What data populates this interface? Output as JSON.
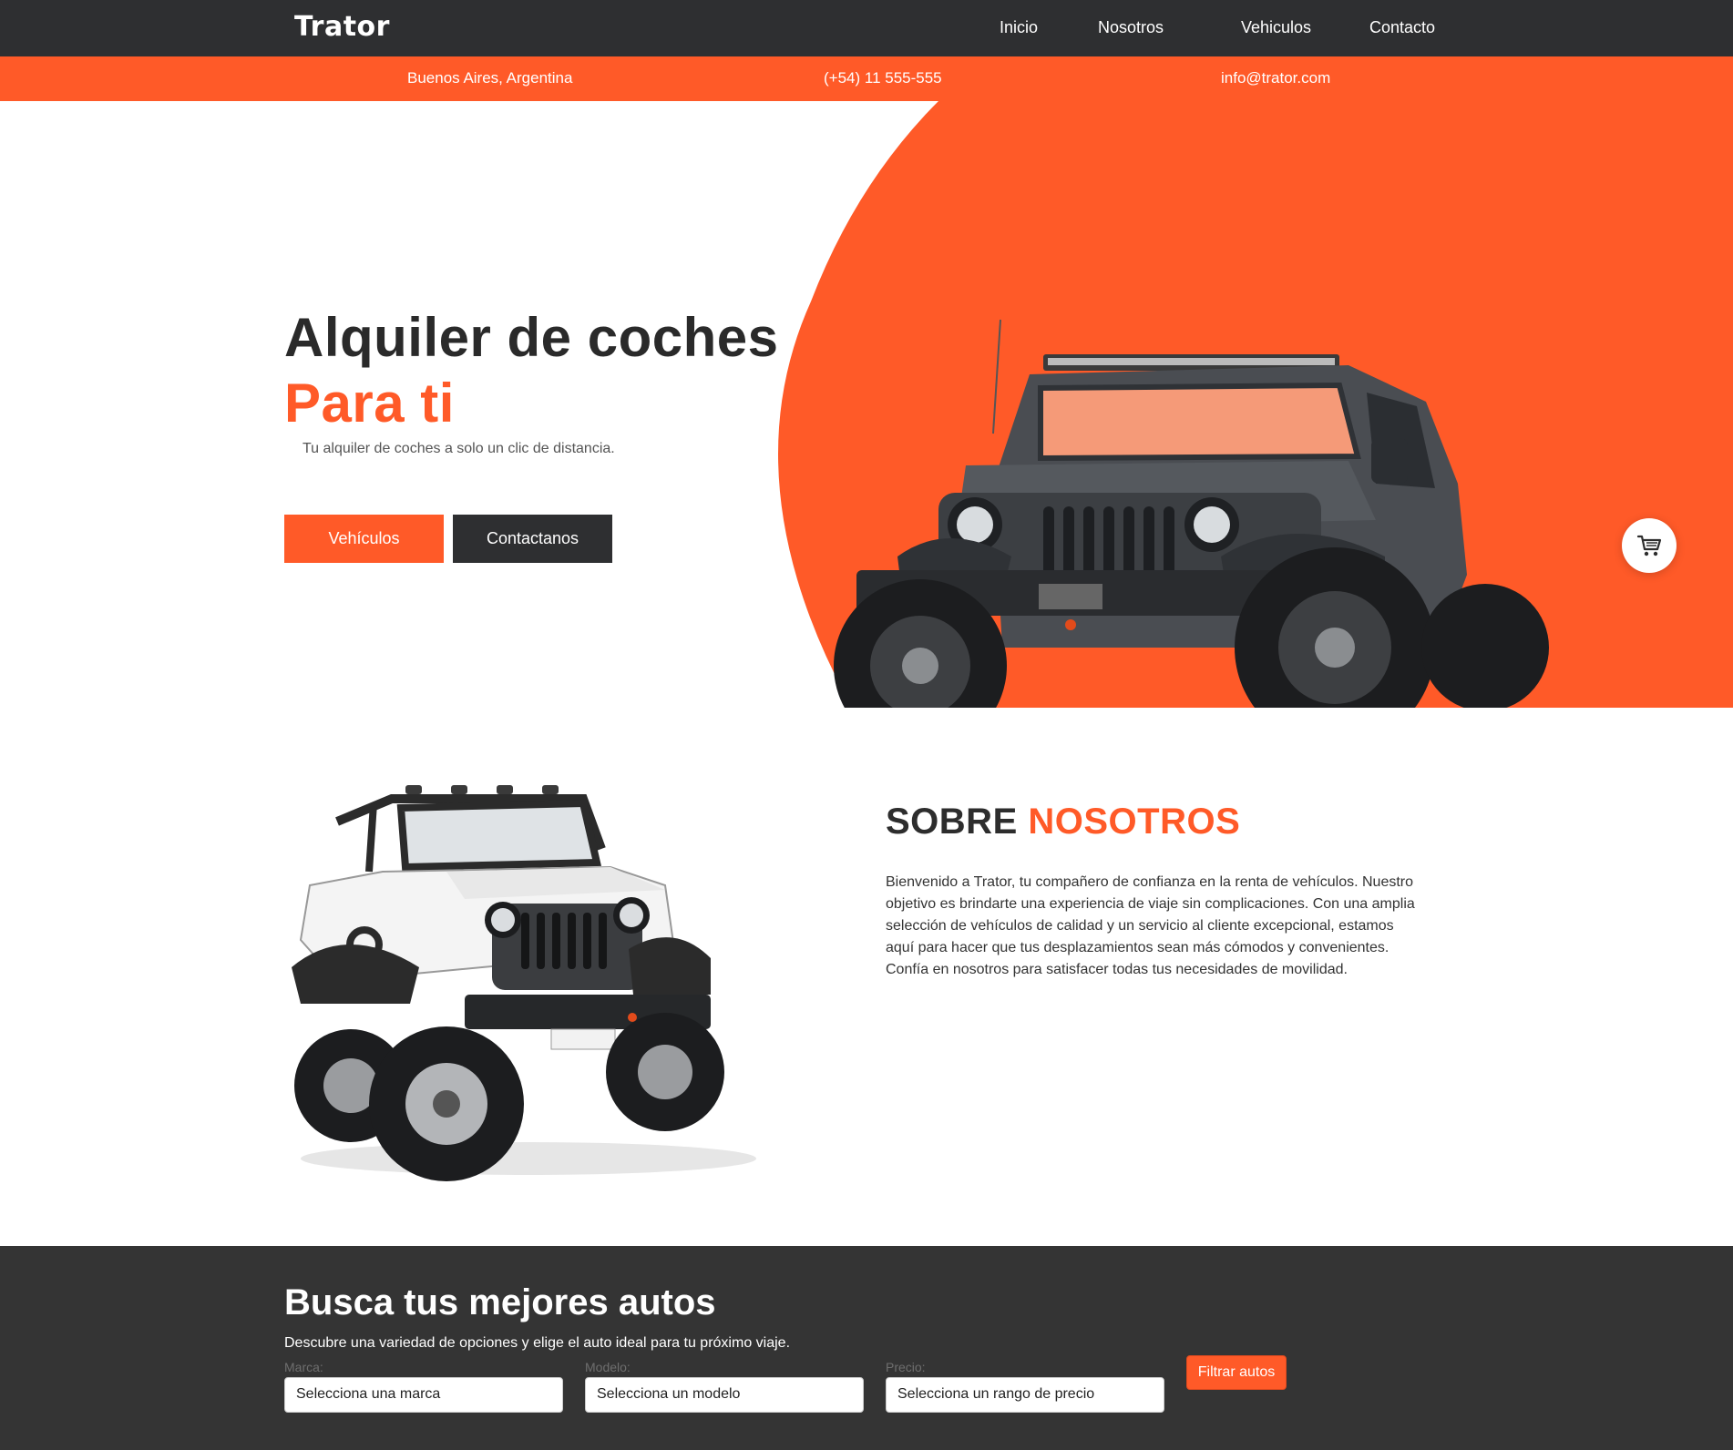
{
  "nav": {
    "brand": "Trator",
    "links": [
      "Inicio",
      "Nosotros",
      "Vehiculos",
      "Contacto"
    ]
  },
  "infobar": {
    "location": "Buenos Aires, Argentina",
    "phone": "(+54) 11 555-555",
    "email": "info@trator.com"
  },
  "hero": {
    "title": "Alquiler de coches",
    "accent": "Para ti",
    "subtitle": "Tu alquiler de coches a solo un clic de distancia.",
    "btn_vehicles": "Vehículos",
    "btn_contact": "Contactanos"
  },
  "about": {
    "title_part1": "SOBRE",
    "title_part2": "NOSOTROS",
    "text": "Bienvenido a Trator, tu compañero de confianza en la renta de vehículos. Nuestro objetivo es brindarte una experiencia de viaje sin complicaciones. Con una amplia selección de vehículos de calidad y un servicio al cliente excepcional, estamos aquí para hacer que tus desplazamientos sean más cómodos y convenientes. Confía en nosotros para satisfacer todas tus necesidades de movilidad."
  },
  "search": {
    "title": "Busca tus mejores autos",
    "description": "Descubre una variedad de opciones y elige el auto ideal para tu próximo viaje.",
    "fields": [
      {
        "label": "Marca:",
        "value": "Selecciona una marca"
      },
      {
        "label": "Modelo:",
        "value": "Selecciona un modelo"
      },
      {
        "label": "Precio:",
        "value": "Selecciona un rango de precio"
      }
    ],
    "filter_button": "Filtrar autos"
  },
  "colors": {
    "accent": "#ff5a28",
    "dark": "#2e2f31",
    "search_bg": "#343434"
  },
  "icons": {
    "cart": "shopping-cart-icon"
  }
}
